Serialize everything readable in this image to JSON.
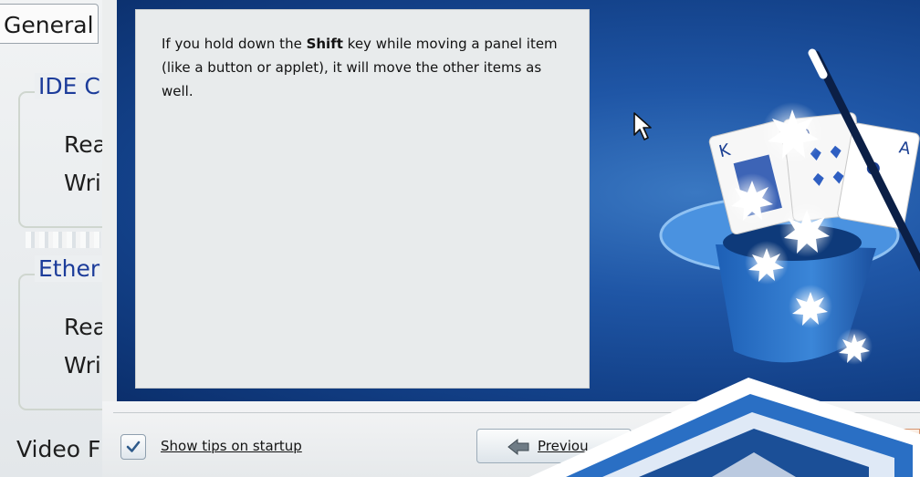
{
  "background_window": {
    "tab_general": "General",
    "groups": [
      {
        "title": "IDE C",
        "lines": [
          "Rea",
          "Wri"
        ]
      },
      {
        "title": "Ether",
        "lines": [
          "Rea",
          "Wri"
        ]
      }
    ],
    "bottom_label": "Video F"
  },
  "tip_dialog": {
    "tip": {
      "prefix": "If you hold down the ",
      "bold_word": "Shift",
      "suffix": " key while moving a panel item (like a button or applet), it will move the other items as well."
    },
    "show_on_startup": {
      "label": "Show tips on startup",
      "checked": true
    },
    "previous_label": "Previou",
    "illustration": "magic-hat-cards-wand"
  },
  "colors": {
    "accent_blue": "#1f56a6",
    "panel_bg": "#e8ebec",
    "group_title": "#1c3c9a",
    "next_button_orange": "#f2cfb6"
  }
}
